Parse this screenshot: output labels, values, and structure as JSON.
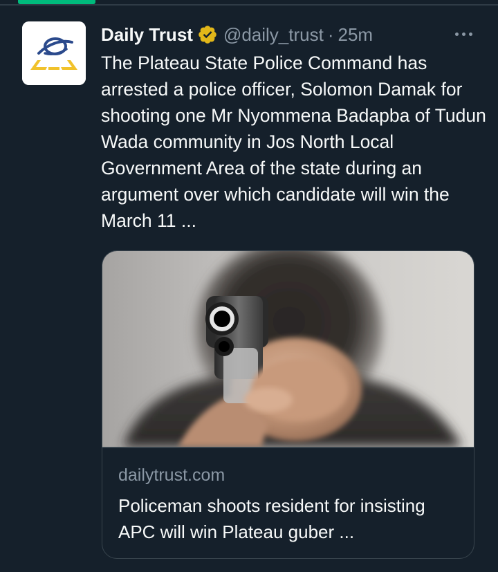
{
  "timeline": {
    "active_tab_color": "#00ba7c"
  },
  "tweet": {
    "author": {
      "display_name": "Daily Trust",
      "handle": "@daily_trust",
      "verified": true,
      "verified_badge_color": "#e2b719",
      "avatar_icon": "daily-trust-logo-icon"
    },
    "separator": "·",
    "time": "25m",
    "more_icon": "more-icon",
    "text": "The Plateau State Police Command has arrested a police officer, Solomon Damak for shooting one Mr Nyommena Badapba of Tudun Wada community in Jos North Local Government Area of the state during an argument over which candidate will win the March 11 ...",
    "card": {
      "image_icon": "handgun-photo",
      "domain": "dailytrust.com",
      "title": "Policeman shoots resident for insisting APC will win Plateau guber ..."
    }
  }
}
